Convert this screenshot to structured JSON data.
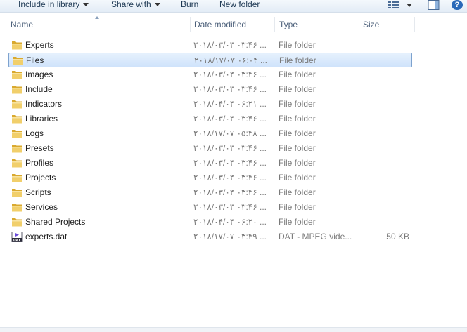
{
  "toolbar": {
    "include_label": "Include in library",
    "share_label": "Share with",
    "burn_label": "Burn",
    "new_folder_label": "New folder",
    "help_label": "?"
  },
  "columns": {
    "name": "Name",
    "date": "Date modified",
    "type": "Type",
    "size": "Size"
  },
  "rows": [
    {
      "name": "Experts",
      "date": "۲۰۱۸/۰۳/۰۳ ۰۳:۴۶ ...",
      "type": "File folder",
      "size": "",
      "icon": "folder-icon"
    },
    {
      "name": "Files",
      "date": "۲۰۱۸/۱۷/۰۷ ۰۶:۰۴ ...",
      "type": "File folder",
      "size": "",
      "icon": "folder-icon",
      "selected": true
    },
    {
      "name": "Images",
      "date": "۲۰۱۸/۰۳/۰۳ ۰۳:۴۶ ...",
      "type": "File folder",
      "size": "",
      "icon": "folder-icon"
    },
    {
      "name": "Include",
      "date": "۲۰۱۸/۰۳/۰۳ ۰۳:۴۶ ...",
      "type": "File folder",
      "size": "",
      "icon": "folder-icon"
    },
    {
      "name": "Indicators",
      "date": "۲۰۱۸/۰۴/۰۳ ۰۶:۲۱ ...",
      "type": "File folder",
      "size": "",
      "icon": "folder-icon"
    },
    {
      "name": "Libraries",
      "date": "۲۰۱۸/۰۳/۰۳ ۰۳:۴۶ ...",
      "type": "File folder",
      "size": "",
      "icon": "folder-icon"
    },
    {
      "name": "Logs",
      "date": "۲۰۱۸/۱۷/۰۷ ۰۵:۴۸ ...",
      "type": "File folder",
      "size": "",
      "icon": "folder-icon"
    },
    {
      "name": "Presets",
      "date": "۲۰۱۸/۰۳/۰۳ ۰۳:۴۶ ...",
      "type": "File folder",
      "size": "",
      "icon": "folder-icon"
    },
    {
      "name": "Profiles",
      "date": "۲۰۱۸/۰۳/۰۳ ۰۳:۴۶ ...",
      "type": "File folder",
      "size": "",
      "icon": "folder-icon"
    },
    {
      "name": "Projects",
      "date": "۲۰۱۸/۰۳/۰۳ ۰۳:۴۶ ...",
      "type": "File folder",
      "size": "",
      "icon": "folder-icon"
    },
    {
      "name": "Scripts",
      "date": "۲۰۱۸/۰۳/۰۳ ۰۳:۴۶ ...",
      "type": "File folder",
      "size": "",
      "icon": "folder-icon"
    },
    {
      "name": "Services",
      "date": "۲۰۱۸/۰۳/۰۳ ۰۳:۴۶ ...",
      "type": "File folder",
      "size": "",
      "icon": "folder-icon"
    },
    {
      "name": "Shared Projects",
      "date": "۲۰۱۸/۰۴/۰۳ ۰۶:۲۰ ...",
      "type": "File folder",
      "size": "",
      "icon": "folder-icon"
    },
    {
      "name": "experts.dat",
      "date": "۲۰۱۸/۱۷/۰۷ ۰۳:۴۹ ...",
      "type": "DAT - MPEG vide...",
      "size": "50 KB",
      "icon": "dat-file-icon"
    }
  ],
  "colors": {
    "toolbar_text": "#1e3954",
    "header_text": "#4c607a",
    "selection_border": "#7da2ce",
    "folder_yellow": "#e8c15a"
  }
}
